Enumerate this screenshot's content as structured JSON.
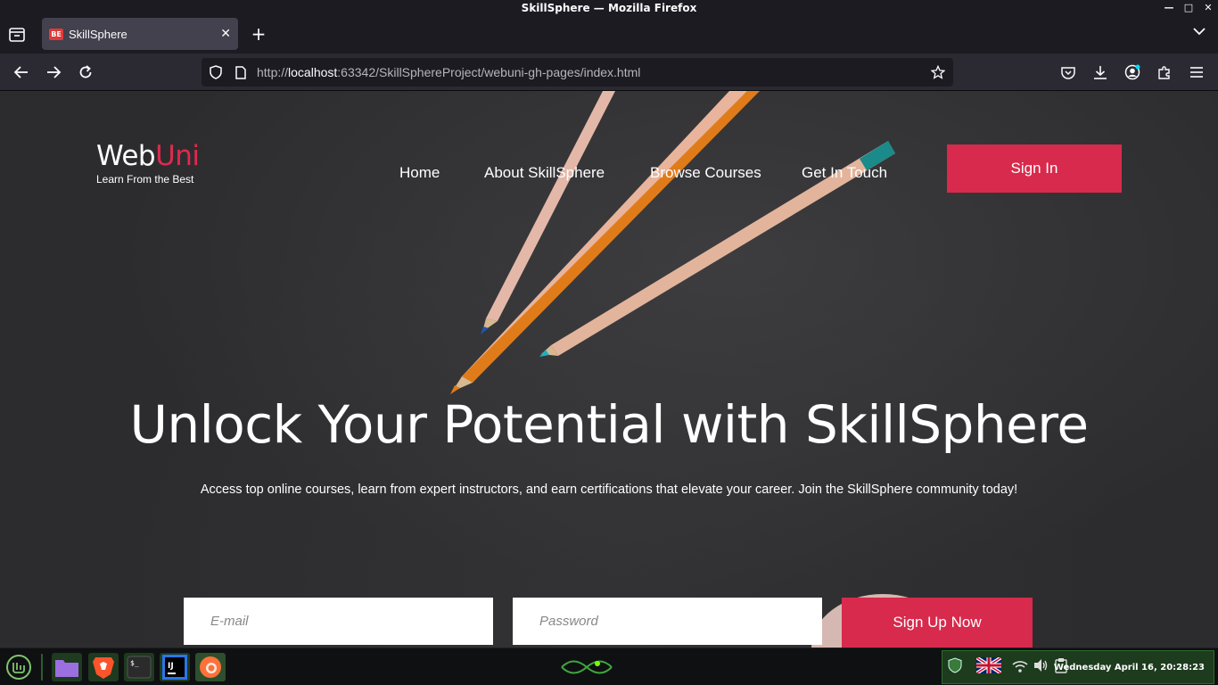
{
  "window": {
    "title": "SkillSphere — Mozilla Firefox"
  },
  "tabs": [
    {
      "label": "SkillSphere",
      "favicon_text": "BE"
    }
  ],
  "urlbar": {
    "scheme": "http://",
    "host": "localhost",
    "rest": ":63342/SkillSphereProject/webuni-gh-pages/index.html"
  },
  "site": {
    "logo_main": "Web",
    "logo_accent": "Uni",
    "tagline": "Learn From the Best",
    "nav": [
      "Home",
      "About SkillSphere",
      "Browse Courses",
      "Get In Touch"
    ],
    "signin_label": "Sign In",
    "hero_title": "Unlock Your Potential with SkillSphere",
    "hero_subtitle": "Access top online courses, learn from expert instructors, and earn certifications that elevate your career. Join the SkillSphere community today!",
    "email_placeholder": "E-mail",
    "password_placeholder": "Password",
    "signup_label": "Sign Up Now",
    "accent_color": "#d82a4c"
  },
  "taskbar": {
    "clock": "Wednesday April 16, 20:28:23",
    "apps": [
      "mint-menu-icon",
      "files-icon",
      "brave-icon",
      "terminal-icon",
      "intellij-icon",
      "firefox-icon"
    ]
  }
}
